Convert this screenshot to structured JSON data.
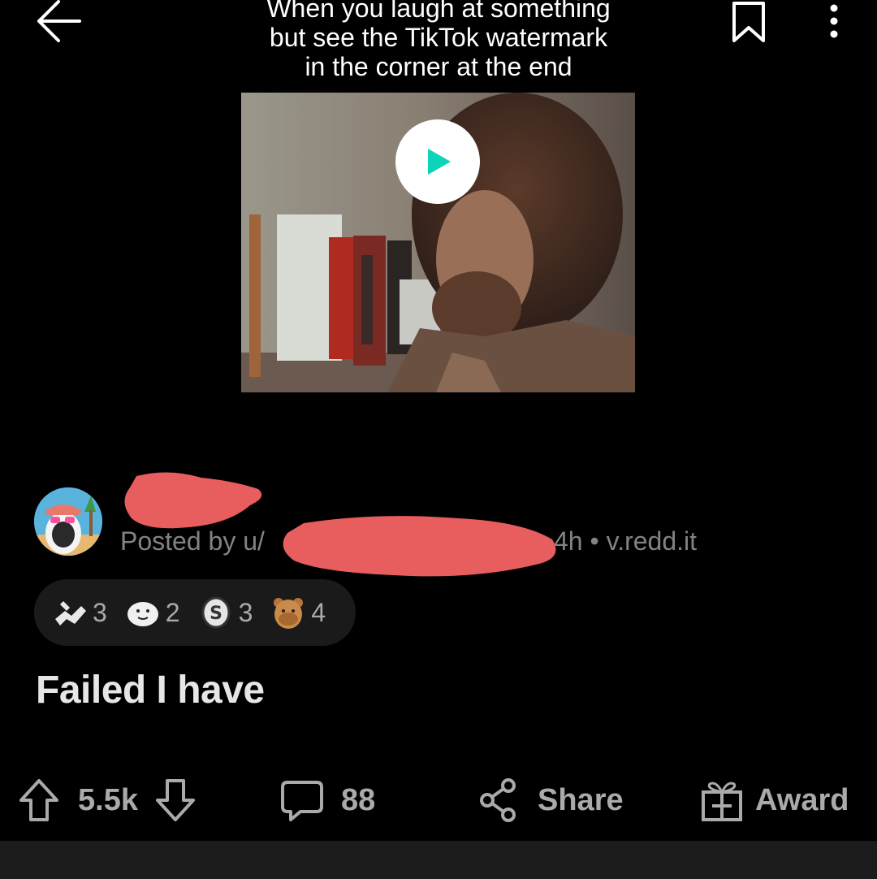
{
  "header": {
    "back_icon": "arrow-left-icon",
    "bookmark_icon": "bookmark-icon",
    "more_icon": "more-vertical-icon"
  },
  "video": {
    "caption_lines": [
      "When you laugh at something",
      "but see the TikTok watermark",
      "in the corner at the end"
    ],
    "play_icon": "play-icon"
  },
  "post": {
    "posted_prefix": "Posted by u/",
    "meta": "• 4h • v.redd.it",
    "title": "Failed I have"
  },
  "awards": [
    {
      "icon": "arm-wrestling-award-icon",
      "count": "3"
    },
    {
      "icon": "seal-award-icon",
      "count": "2"
    },
    {
      "icon": "silver-coin-award-icon",
      "count": "3"
    },
    {
      "icon": "bear-award-icon",
      "count": "4"
    }
  ],
  "actions": {
    "upvote_count": "5.5k",
    "comment_count": "88",
    "share_label": "Share",
    "award_label": "Award"
  },
  "colors": {
    "background": "#000000",
    "redaction": "#e85d5d",
    "muted_text": "#818384",
    "accent_play": "#0dd3bb"
  }
}
